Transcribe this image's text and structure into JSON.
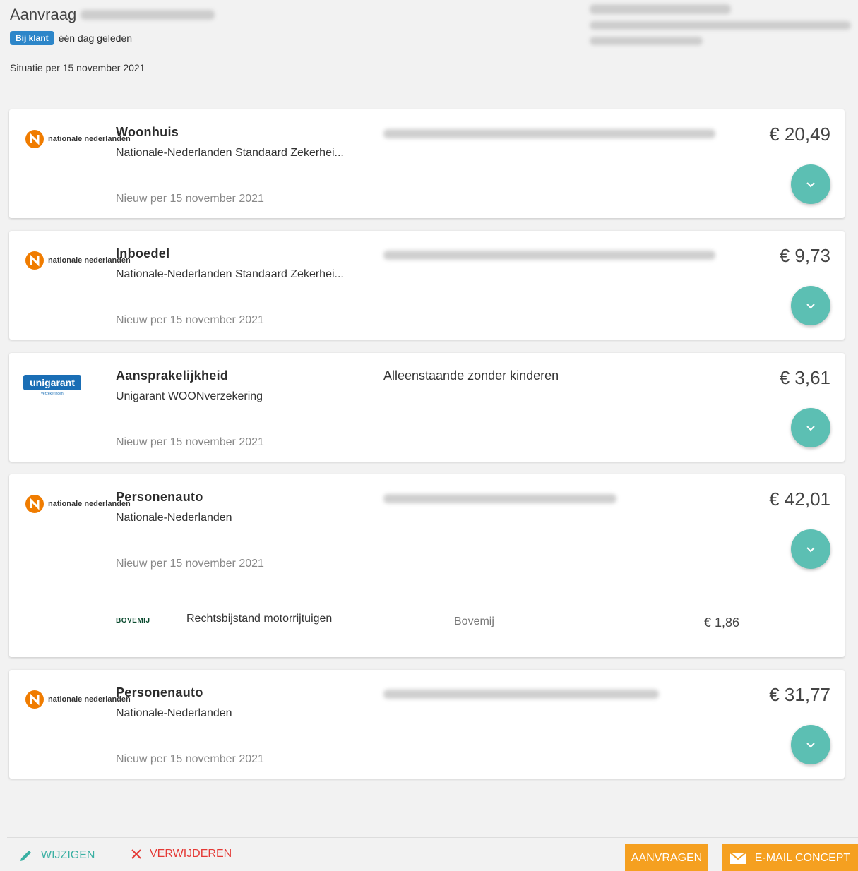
{
  "header": {
    "title": "Aanvraag",
    "status_badge": "Bij klant",
    "status_time": "één dag geleden",
    "situation": "Situatie per 15 november 2021"
  },
  "cards": [
    {
      "insurer": "nationale nederlanden",
      "product": "Woonhuis",
      "subtitle": "Nationale-Nederlanden Standaard Zekerhei...",
      "detail": "",
      "price": "€ 20,49",
      "new_since": "Nieuw per 15 november 2021"
    },
    {
      "insurer": "nationale nederlanden",
      "product": "Inboedel",
      "subtitle": "Nationale-Nederlanden Standaard Zekerhei...",
      "detail": "",
      "price": "€ 9,73",
      "new_since": "Nieuw per 15 november 2021"
    },
    {
      "insurer": "unigarant",
      "insurer_tagline": "verzekeringen",
      "product": "Aansprakelijkheid",
      "subtitle": "Unigarant WOONverzekering",
      "detail": "Alleenstaande zonder kinderen",
      "price": "€ 3,61",
      "new_since": "Nieuw per 15 november 2021"
    },
    {
      "insurer": "nationale nederlanden",
      "product": "Personenauto",
      "subtitle": "Nationale-Nederlanden",
      "detail": "",
      "price": "€ 42,01",
      "new_since": "Nieuw per 15 november 2021",
      "sub_item": {
        "logo_text": "BOVEMIJ",
        "name": "Rechtsbijstand motorrijtuigen",
        "insurer": "Bovemij",
        "price": "€ 1,86"
      }
    },
    {
      "insurer": "nationale nederlanden",
      "product": "Personenauto",
      "subtitle": "Nationale-Nederlanden",
      "detail": "",
      "price": "€ 31,77",
      "new_since": "Nieuw per 15 november 2021"
    }
  ],
  "footer": {
    "edit_label": "WIJZIGEN",
    "delete_label": "VERWIJDEREN",
    "request_label": "AANVRAGEN",
    "email_label": "E-MAIL CONCEPT"
  },
  "colors": {
    "accent_teal": "#5cbfb3",
    "badge_blue": "#2d86c9",
    "action_orange": "#f5a020",
    "delete_red": "#e53935",
    "nn_orange": "#f07c00"
  }
}
